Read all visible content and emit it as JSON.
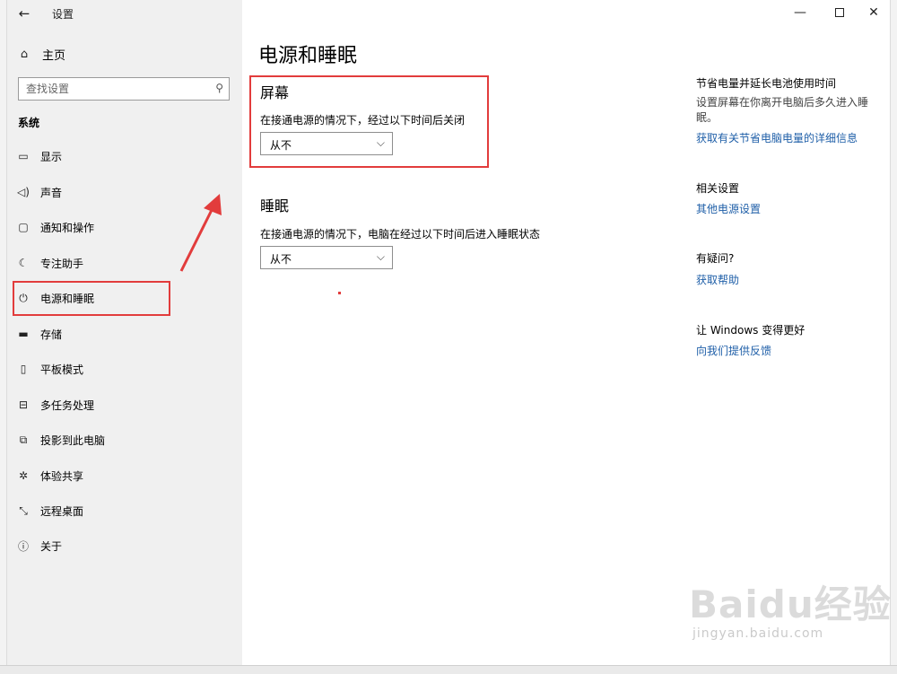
{
  "titlebar": {
    "back_icon": "back-arrow-icon",
    "title": "设置",
    "minimize": "—",
    "maximize_icon": "maximize-icon",
    "close": "✕"
  },
  "sidebar": {
    "home_label": "主页",
    "search_placeholder": "查找设置",
    "section_label": "系统",
    "items": [
      {
        "label": "显示",
        "icon": "display-icon"
      },
      {
        "label": "声音",
        "icon": "speaker-icon"
      },
      {
        "label": "通知和操作",
        "icon": "notification-icon"
      },
      {
        "label": "专注助手",
        "icon": "moon-icon"
      },
      {
        "label": "电源和睡眠",
        "icon": "power-icon"
      },
      {
        "label": "存储",
        "icon": "storage-icon"
      },
      {
        "label": "平板模式",
        "icon": "tablet-icon"
      },
      {
        "label": "多任务处理",
        "icon": "multitask-icon"
      },
      {
        "label": "投影到此电脑",
        "icon": "project-icon"
      },
      {
        "label": "体验共享",
        "icon": "share-icon"
      },
      {
        "label": "远程桌面",
        "icon": "remote-desktop-icon"
      },
      {
        "label": "关于",
        "icon": "info-icon"
      }
    ]
  },
  "main": {
    "title": "电源和睡眠",
    "screen": {
      "heading": "屏幕",
      "description": "在接通电源的情况下，经过以下时间后关闭",
      "value": "从不"
    },
    "sleep": {
      "heading": "睡眠",
      "description": "在接通电源的情况下，电脑在经过以下时间后进入睡眠状态",
      "value": "从不"
    }
  },
  "right_panel": {
    "save_power": {
      "title": "节省电量并延长电池使用时间",
      "text": "设置屏幕在你离开电脑后多久进入睡眠。",
      "link": "获取有关节省电脑电量的详细信息"
    },
    "related": {
      "title": "相关设置",
      "link": "其他电源设置"
    },
    "help": {
      "title": "有疑问?",
      "link": "获取帮助"
    },
    "feedback": {
      "title": "让 Windows 变得更好",
      "link": "向我们提供反馈"
    }
  },
  "watermark": {
    "main": "Baidu经验",
    "sub": "jingyan.baidu.com"
  },
  "colors": {
    "link": "#1f5fa8",
    "annotation_red": "#e23c3c",
    "sidebar_bg": "#f0f0f0"
  }
}
